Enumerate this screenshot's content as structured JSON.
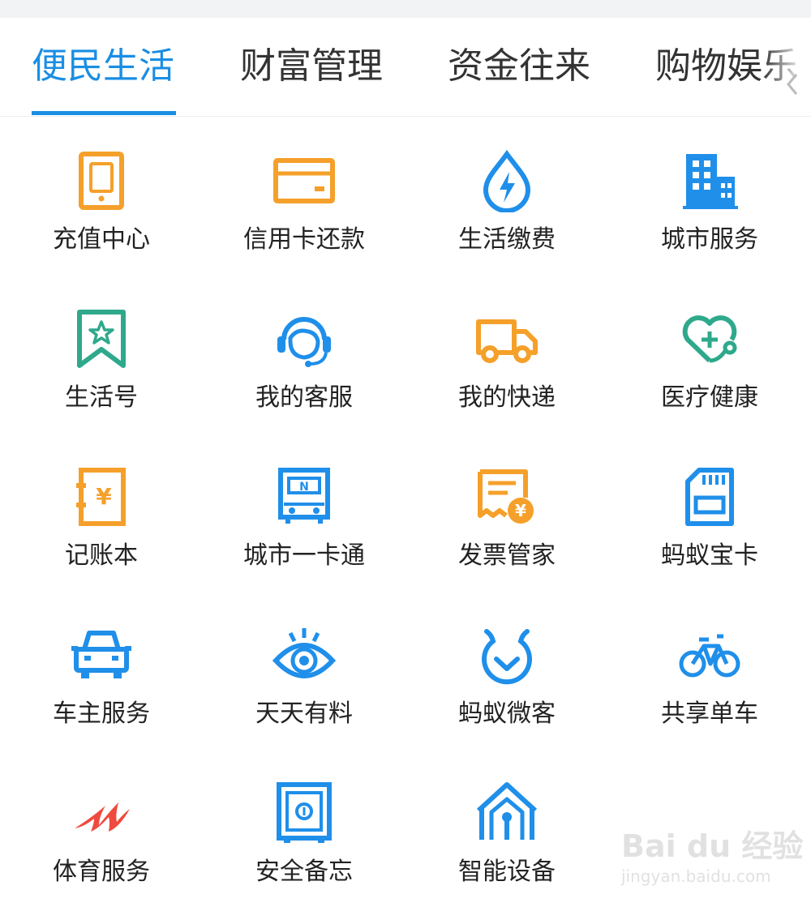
{
  "tabs": [
    {
      "label": "便民生活",
      "active": true
    },
    {
      "label": "财富管理",
      "active": false
    },
    {
      "label": "资金往来",
      "active": false
    },
    {
      "label": "购物娱乐",
      "active": false
    }
  ],
  "colors": {
    "accent": "#1a8ee3",
    "orange": "#f5a02a",
    "blue": "#1f8fea",
    "green": "#2ea98b",
    "red": "#ef4a3f",
    "text": "#222222"
  },
  "services": [
    {
      "label": "充值中心",
      "icon": "phone-recharge-icon"
    },
    {
      "label": "信用卡还款",
      "icon": "credit-card-icon"
    },
    {
      "label": "生活缴费",
      "icon": "utility-drop-icon"
    },
    {
      "label": "城市服务",
      "icon": "city-building-icon"
    },
    {
      "label": "生活号",
      "icon": "bookmark-star-icon"
    },
    {
      "label": "我的客服",
      "icon": "headset-agent-icon"
    },
    {
      "label": "我的快递",
      "icon": "delivery-truck-icon"
    },
    {
      "label": "医疗健康",
      "icon": "stethoscope-heart-icon"
    },
    {
      "label": "记账本",
      "icon": "ledger-yen-icon"
    },
    {
      "label": "城市一卡通",
      "icon": "transit-card-icon"
    },
    {
      "label": "发票管家",
      "icon": "invoice-yen-icon"
    },
    {
      "label": "蚂蚁宝卡",
      "icon": "sim-card-icon"
    },
    {
      "label": "车主服务",
      "icon": "car-icon"
    },
    {
      "label": "天天有料",
      "icon": "eye-icon"
    },
    {
      "label": "蚂蚁微客",
      "icon": "ant-shield-icon"
    },
    {
      "label": "共享单车",
      "icon": "bicycle-icon"
    },
    {
      "label": "体育服务",
      "icon": "sports-swoosh-icon"
    },
    {
      "label": "安全备忘",
      "icon": "safe-box-icon"
    },
    {
      "label": "智能设备",
      "icon": "smart-home-icon"
    }
  ],
  "watermark": {
    "main": "Bai du 经验",
    "sub": "jingyan.baidu.com"
  }
}
